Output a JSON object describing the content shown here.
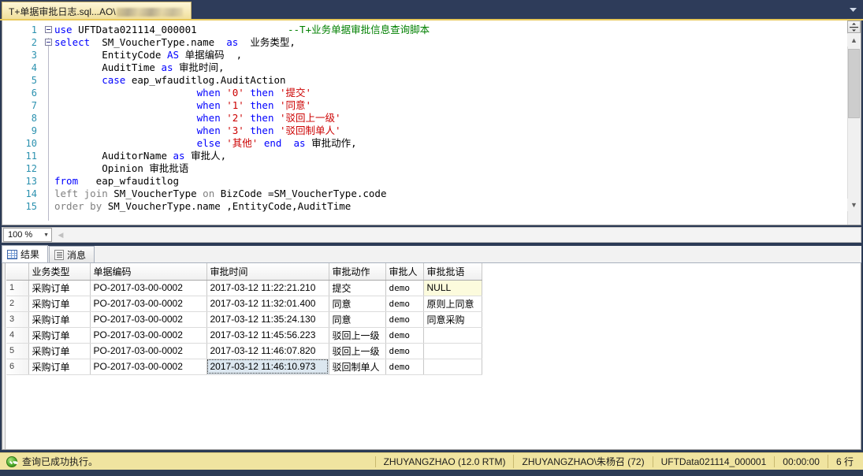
{
  "window": {
    "tab_title": "T+单据审批日志.sql...AO\\",
    "tab_title_redacted": true,
    "tabbar_chevron_icon": "chevron-down-icon"
  },
  "editor": {
    "right_comment": "--T+业务单据审批信息查询脚本",
    "lines": [
      {
        "n": "1",
        "fold": true,
        "segments": [
          {
            "t": "use",
            "c": "kw"
          },
          {
            "t": " UFTData021114_000001",
            "c": "plain"
          }
        ]
      },
      {
        "n": "2",
        "fold": true,
        "segments": [
          {
            "t": "select",
            "c": "kw"
          },
          {
            "t": "  SM_VoucherType.name  ",
            "c": "plain"
          },
          {
            "t": "as",
            "c": "kw"
          },
          {
            "t": "  业务类型,",
            "c": "plain"
          }
        ]
      },
      {
        "n": "3",
        "fold": false,
        "segments": [
          {
            "t": "        EntityCode ",
            "c": "plain"
          },
          {
            "t": "AS",
            "c": "kw"
          },
          {
            "t": " 单据编码  ,",
            "c": "plain"
          }
        ]
      },
      {
        "n": "4",
        "fold": false,
        "segments": [
          {
            "t": "        AuditTime ",
            "c": "plain"
          },
          {
            "t": "as",
            "c": "kw"
          },
          {
            "t": " 审批时间,",
            "c": "plain"
          }
        ]
      },
      {
        "n": "5",
        "fold": false,
        "segments": [
          {
            "t": "        ",
            "c": "plain"
          },
          {
            "t": "case",
            "c": "kw"
          },
          {
            "t": " eap_wfauditlog.AuditAction",
            "c": "plain"
          }
        ]
      },
      {
        "n": "6",
        "fold": false,
        "segments": [
          {
            "t": "                        ",
            "c": "plain"
          },
          {
            "t": "when",
            "c": "kw"
          },
          {
            "t": " '0' ",
            "c": "str"
          },
          {
            "t": "then",
            "c": "kw"
          },
          {
            "t": " '提交'",
            "c": "str"
          }
        ]
      },
      {
        "n": "7",
        "fold": false,
        "segments": [
          {
            "t": "                        ",
            "c": "plain"
          },
          {
            "t": "when",
            "c": "kw"
          },
          {
            "t": " '1' ",
            "c": "str"
          },
          {
            "t": "then",
            "c": "kw"
          },
          {
            "t": " '同意'",
            "c": "str"
          }
        ]
      },
      {
        "n": "8",
        "fold": false,
        "segments": [
          {
            "t": "                        ",
            "c": "plain"
          },
          {
            "t": "when",
            "c": "kw"
          },
          {
            "t": " '2' ",
            "c": "str"
          },
          {
            "t": "then",
            "c": "kw"
          },
          {
            "t": " '驳回上一级'",
            "c": "str"
          }
        ]
      },
      {
        "n": "9",
        "fold": false,
        "segments": [
          {
            "t": "                        ",
            "c": "plain"
          },
          {
            "t": "when",
            "c": "kw"
          },
          {
            "t": " '3' ",
            "c": "str"
          },
          {
            "t": "then",
            "c": "kw"
          },
          {
            "t": " '驳回制单人'",
            "c": "str"
          }
        ]
      },
      {
        "n": "10",
        "fold": false,
        "segments": [
          {
            "t": "                        ",
            "c": "plain"
          },
          {
            "t": "else",
            "c": "kw"
          },
          {
            "t": " '其他' ",
            "c": "str"
          },
          {
            "t": "end",
            "c": "kw"
          },
          {
            "t": "  ",
            "c": "plain"
          },
          {
            "t": "as",
            "c": "kw"
          },
          {
            "t": " 审批动作,",
            "c": "plain"
          }
        ]
      },
      {
        "n": "11",
        "fold": false,
        "segments": [
          {
            "t": "        AuditorName ",
            "c": "plain"
          },
          {
            "t": "as",
            "c": "kw"
          },
          {
            "t": " 审批人,",
            "c": "plain"
          }
        ]
      },
      {
        "n": "12",
        "fold": false,
        "segments": [
          {
            "t": "        Opinion 审批批语",
            "c": "plain"
          }
        ]
      },
      {
        "n": "13",
        "fold": false,
        "segments": [
          {
            "t": "from",
            "c": "kw"
          },
          {
            "t": "   eap_wfauditlog",
            "c": "plain"
          }
        ]
      },
      {
        "n": "14",
        "fold": false,
        "segments": [
          {
            "t": "left",
            "c": "gray"
          },
          {
            "t": " ",
            "c": "plain"
          },
          {
            "t": "join",
            "c": "gray"
          },
          {
            "t": " SM_VoucherType ",
            "c": "plain"
          },
          {
            "t": "on",
            "c": "gray"
          },
          {
            "t": " BizCode =SM_VoucherType.code",
            "c": "plain"
          }
        ]
      },
      {
        "n": "15",
        "fold": false,
        "segments": [
          {
            "t": "order",
            "c": "gray"
          },
          {
            "t": " ",
            "c": "plain"
          },
          {
            "t": "by",
            "c": "gray"
          },
          {
            "t": " SM_VoucherType.name ,EntityCode,AuditTime",
            "c": "plain"
          }
        ]
      }
    ]
  },
  "zoom_bar": {
    "value": "100 %",
    "caret_icon": "chevron-down-icon",
    "scroll_left_icon": "chevron-left-icon"
  },
  "result_tabs": [
    {
      "label": "结果",
      "icon": "grid-icon",
      "active": true
    },
    {
      "label": "消息",
      "icon": "message-icon",
      "active": false
    }
  ],
  "grid": {
    "columns": [
      "业务类型",
      "单据编码",
      "审批时间",
      "审批动作",
      "审批人",
      "审批批语"
    ],
    "rows": [
      {
        "n": "1",
        "cells": [
          "采购订单",
          "PO-2017-03-00-0002",
          "2017-03-12 11:22:21.210",
          "提交",
          "demo",
          "NULL"
        ],
        "null_index": 5,
        "selected_index": -1
      },
      {
        "n": "2",
        "cells": [
          "采购订单",
          "PO-2017-03-00-0002",
          "2017-03-12 11:32:01.400",
          "同意",
          "demo",
          "原则上同意"
        ],
        "null_index": -1,
        "selected_index": -1
      },
      {
        "n": "3",
        "cells": [
          "采购订单",
          "PO-2017-03-00-0002",
          "2017-03-12 11:35:24.130",
          "同意",
          "demo",
          "同意采购"
        ],
        "null_index": -1,
        "selected_index": -1
      },
      {
        "n": "4",
        "cells": [
          "采购订单",
          "PO-2017-03-00-0002",
          "2017-03-12 11:45:56.223",
          "驳回上一级",
          "demo",
          ""
        ],
        "null_index": -1,
        "selected_index": -1
      },
      {
        "n": "5",
        "cells": [
          "采购订单",
          "PO-2017-03-00-0002",
          "2017-03-12 11:46:07.820",
          "驳回上一级",
          "demo",
          ""
        ],
        "null_index": -1,
        "selected_index": -1
      },
      {
        "n": "6",
        "cells": [
          "采购订单",
          "PO-2017-03-00-0002",
          "2017-03-12 11:46:10.973",
          "驳回制单人",
          "demo",
          ""
        ],
        "null_index": -1,
        "selected_index": 2
      }
    ]
  },
  "status_bar": {
    "message": "查询已成功执行。",
    "status_icon": "success-check-icon",
    "server": "ZHUYANGZHAO (12.0 RTM)",
    "user": "ZHUYANGZHAO\\朱杨召 (72)",
    "database": "UFTData021114_000001",
    "elapsed": "00:00:00",
    "row_count": "6 行"
  },
  "colors": {
    "tabbar_bg": "#2e3c5a",
    "active_tab": "#f6e9b4",
    "status_bg": "#f0e4a0",
    "keyword": "#0000ff",
    "string": "#cc0000",
    "comment": "#008000",
    "linenum": "#2b91af"
  }
}
